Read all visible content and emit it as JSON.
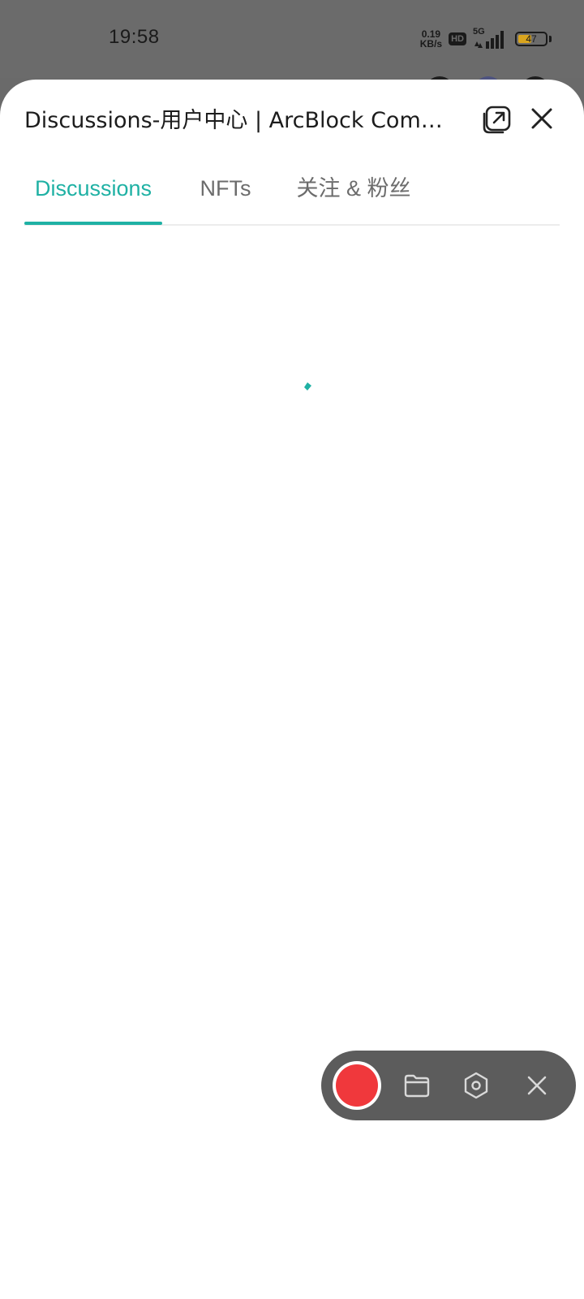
{
  "status_bar": {
    "time": "19:58",
    "net_speed_value": "0.19",
    "net_speed_unit": "KB/s",
    "hd_badge": "HD",
    "network": "5G",
    "battery_level": "47"
  },
  "sheet": {
    "title": "Discussions-用户中心 | ArcBlock Comm…",
    "icons": {
      "open_external": "open-in-new-icon",
      "close": "close-icon"
    }
  },
  "tabs": [
    {
      "label": "Discussions",
      "active": true
    },
    {
      "label": "NFTs",
      "active": false
    },
    {
      "label": "关注 & 粉丝",
      "active": false
    }
  ],
  "colors": {
    "accent": "#1fb1a4",
    "record": "#f0383c",
    "recorder_bg": "#5c5c5c",
    "battery": "#d9a51e"
  },
  "recorder": {
    "icons": [
      "record-icon",
      "folder-icon",
      "settings-hex-icon",
      "close-icon"
    ]
  }
}
